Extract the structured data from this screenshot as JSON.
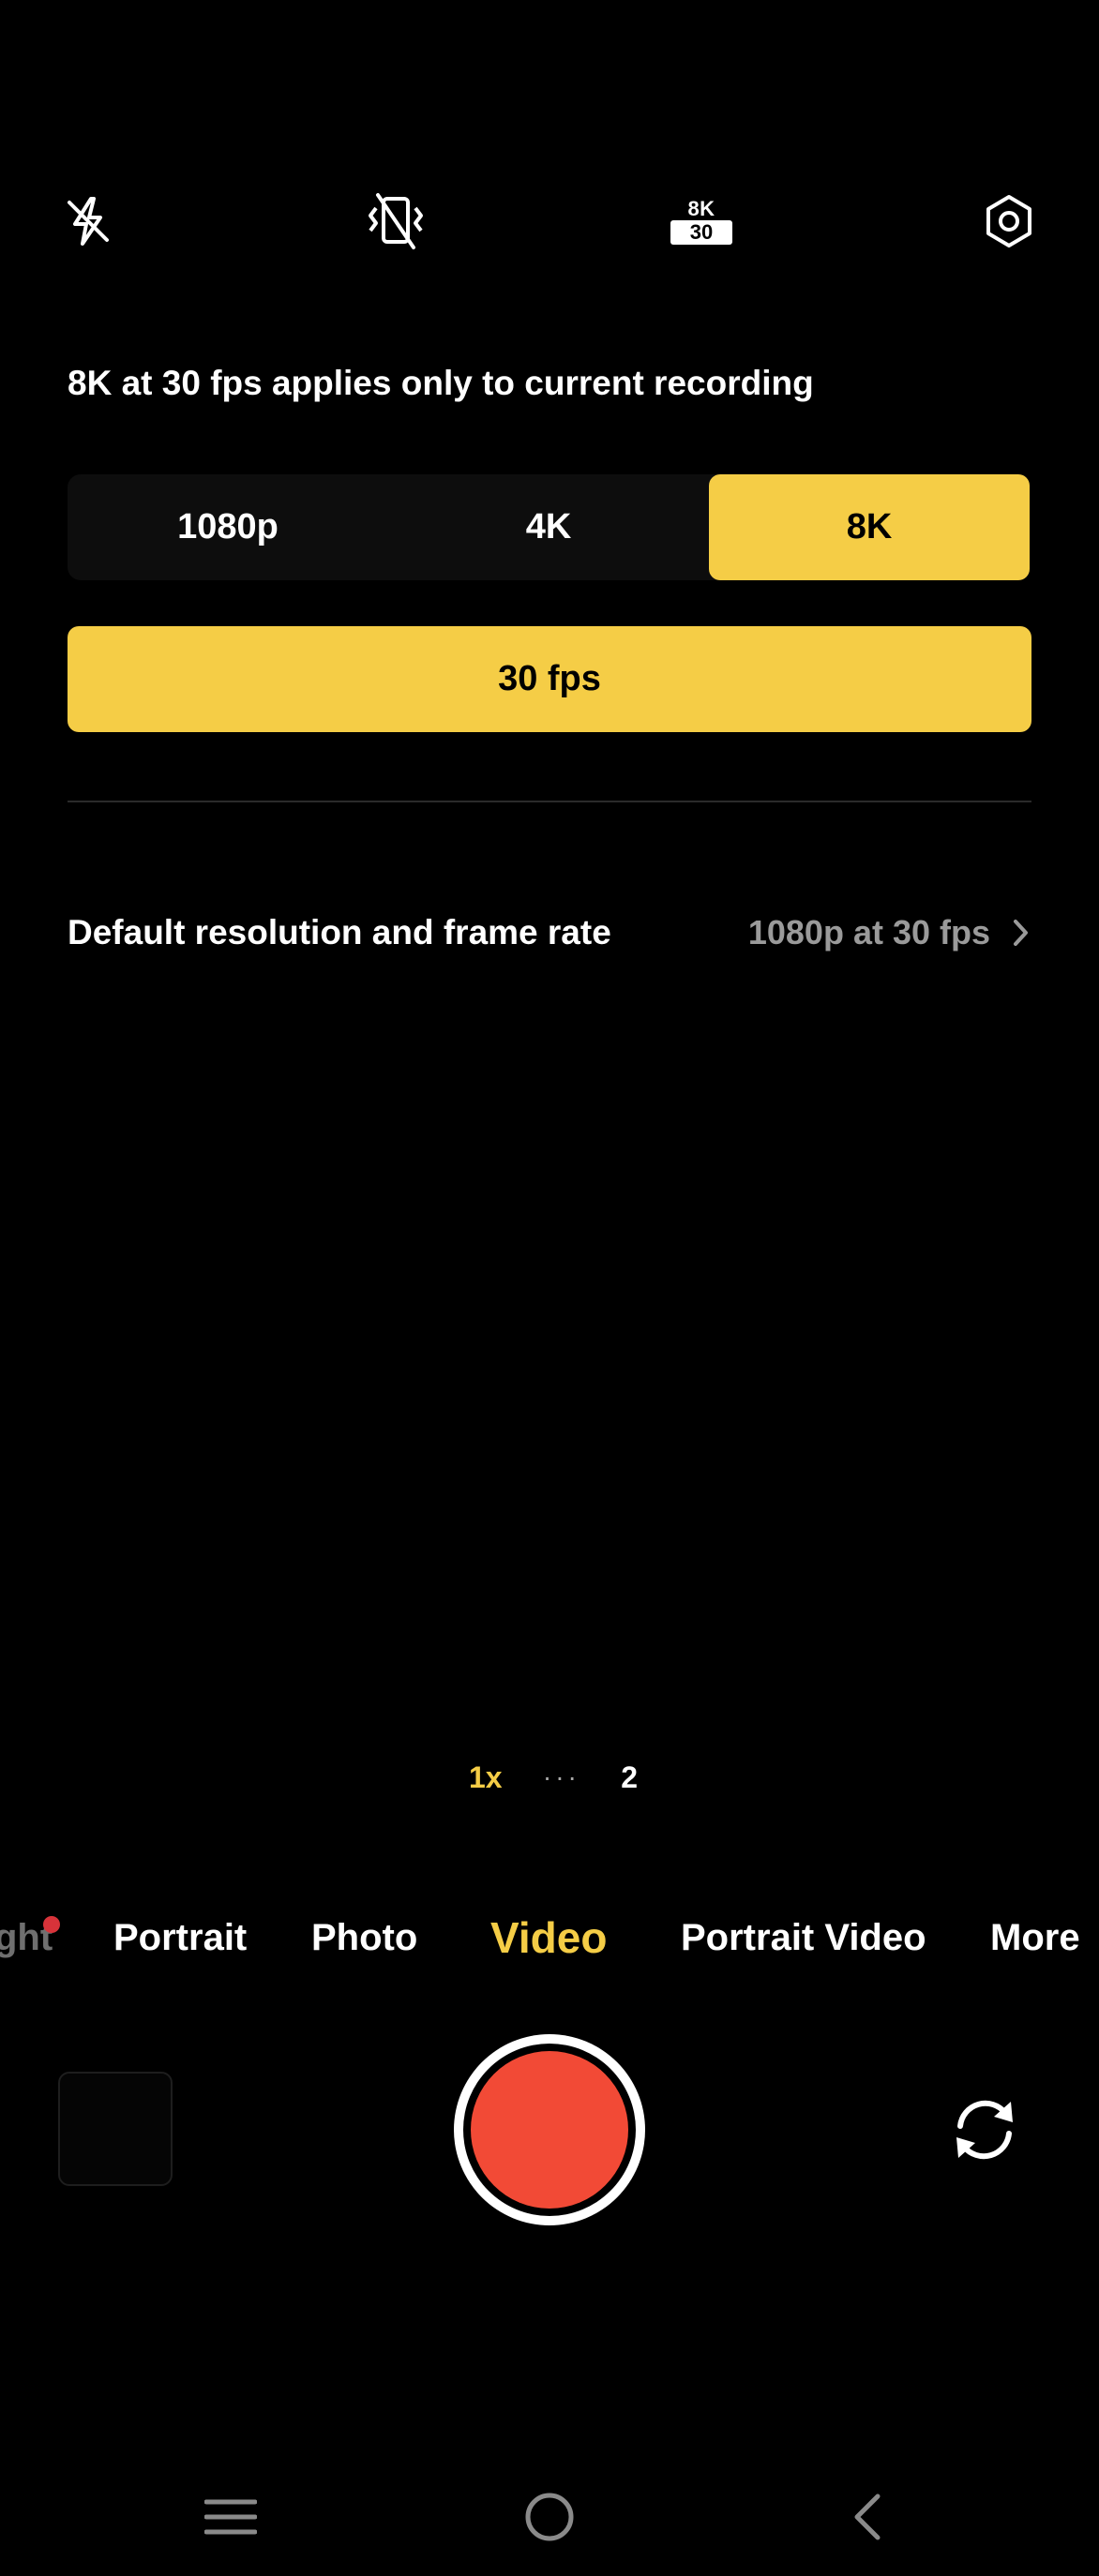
{
  "toolbar": {
    "flash_icon": "flash-off-icon",
    "stabilization_icon": "stabilization-off-icon",
    "resolution_badge": {
      "resolution": "8K",
      "fps": "30"
    },
    "settings_icon": "settings-icon"
  },
  "hint_text": "8K at 30 fps applies only to current recording",
  "resolution_options": [
    {
      "label": "1080p",
      "selected": false
    },
    {
      "label": "4K",
      "selected": false
    },
    {
      "label": "8K",
      "selected": true
    }
  ],
  "fps_option": {
    "label": "30 fps",
    "selected": true
  },
  "default_setting": {
    "label": "Default resolution and frame rate",
    "value": "1080p at 30 fps"
  },
  "zoom": {
    "current": "1x",
    "separator": "···",
    "next": "2"
  },
  "modes": [
    {
      "label": "ght",
      "has_dot": true
    },
    {
      "label": "Portrait"
    },
    {
      "label": "Photo"
    },
    {
      "label": "Video",
      "active": true
    },
    {
      "label": "Portrait Video"
    },
    {
      "label": "More"
    }
  ],
  "colors": {
    "accent": "#f5cd46",
    "record": "#f24a36",
    "background": "#000000",
    "muted_text": "#9a9a9a"
  }
}
